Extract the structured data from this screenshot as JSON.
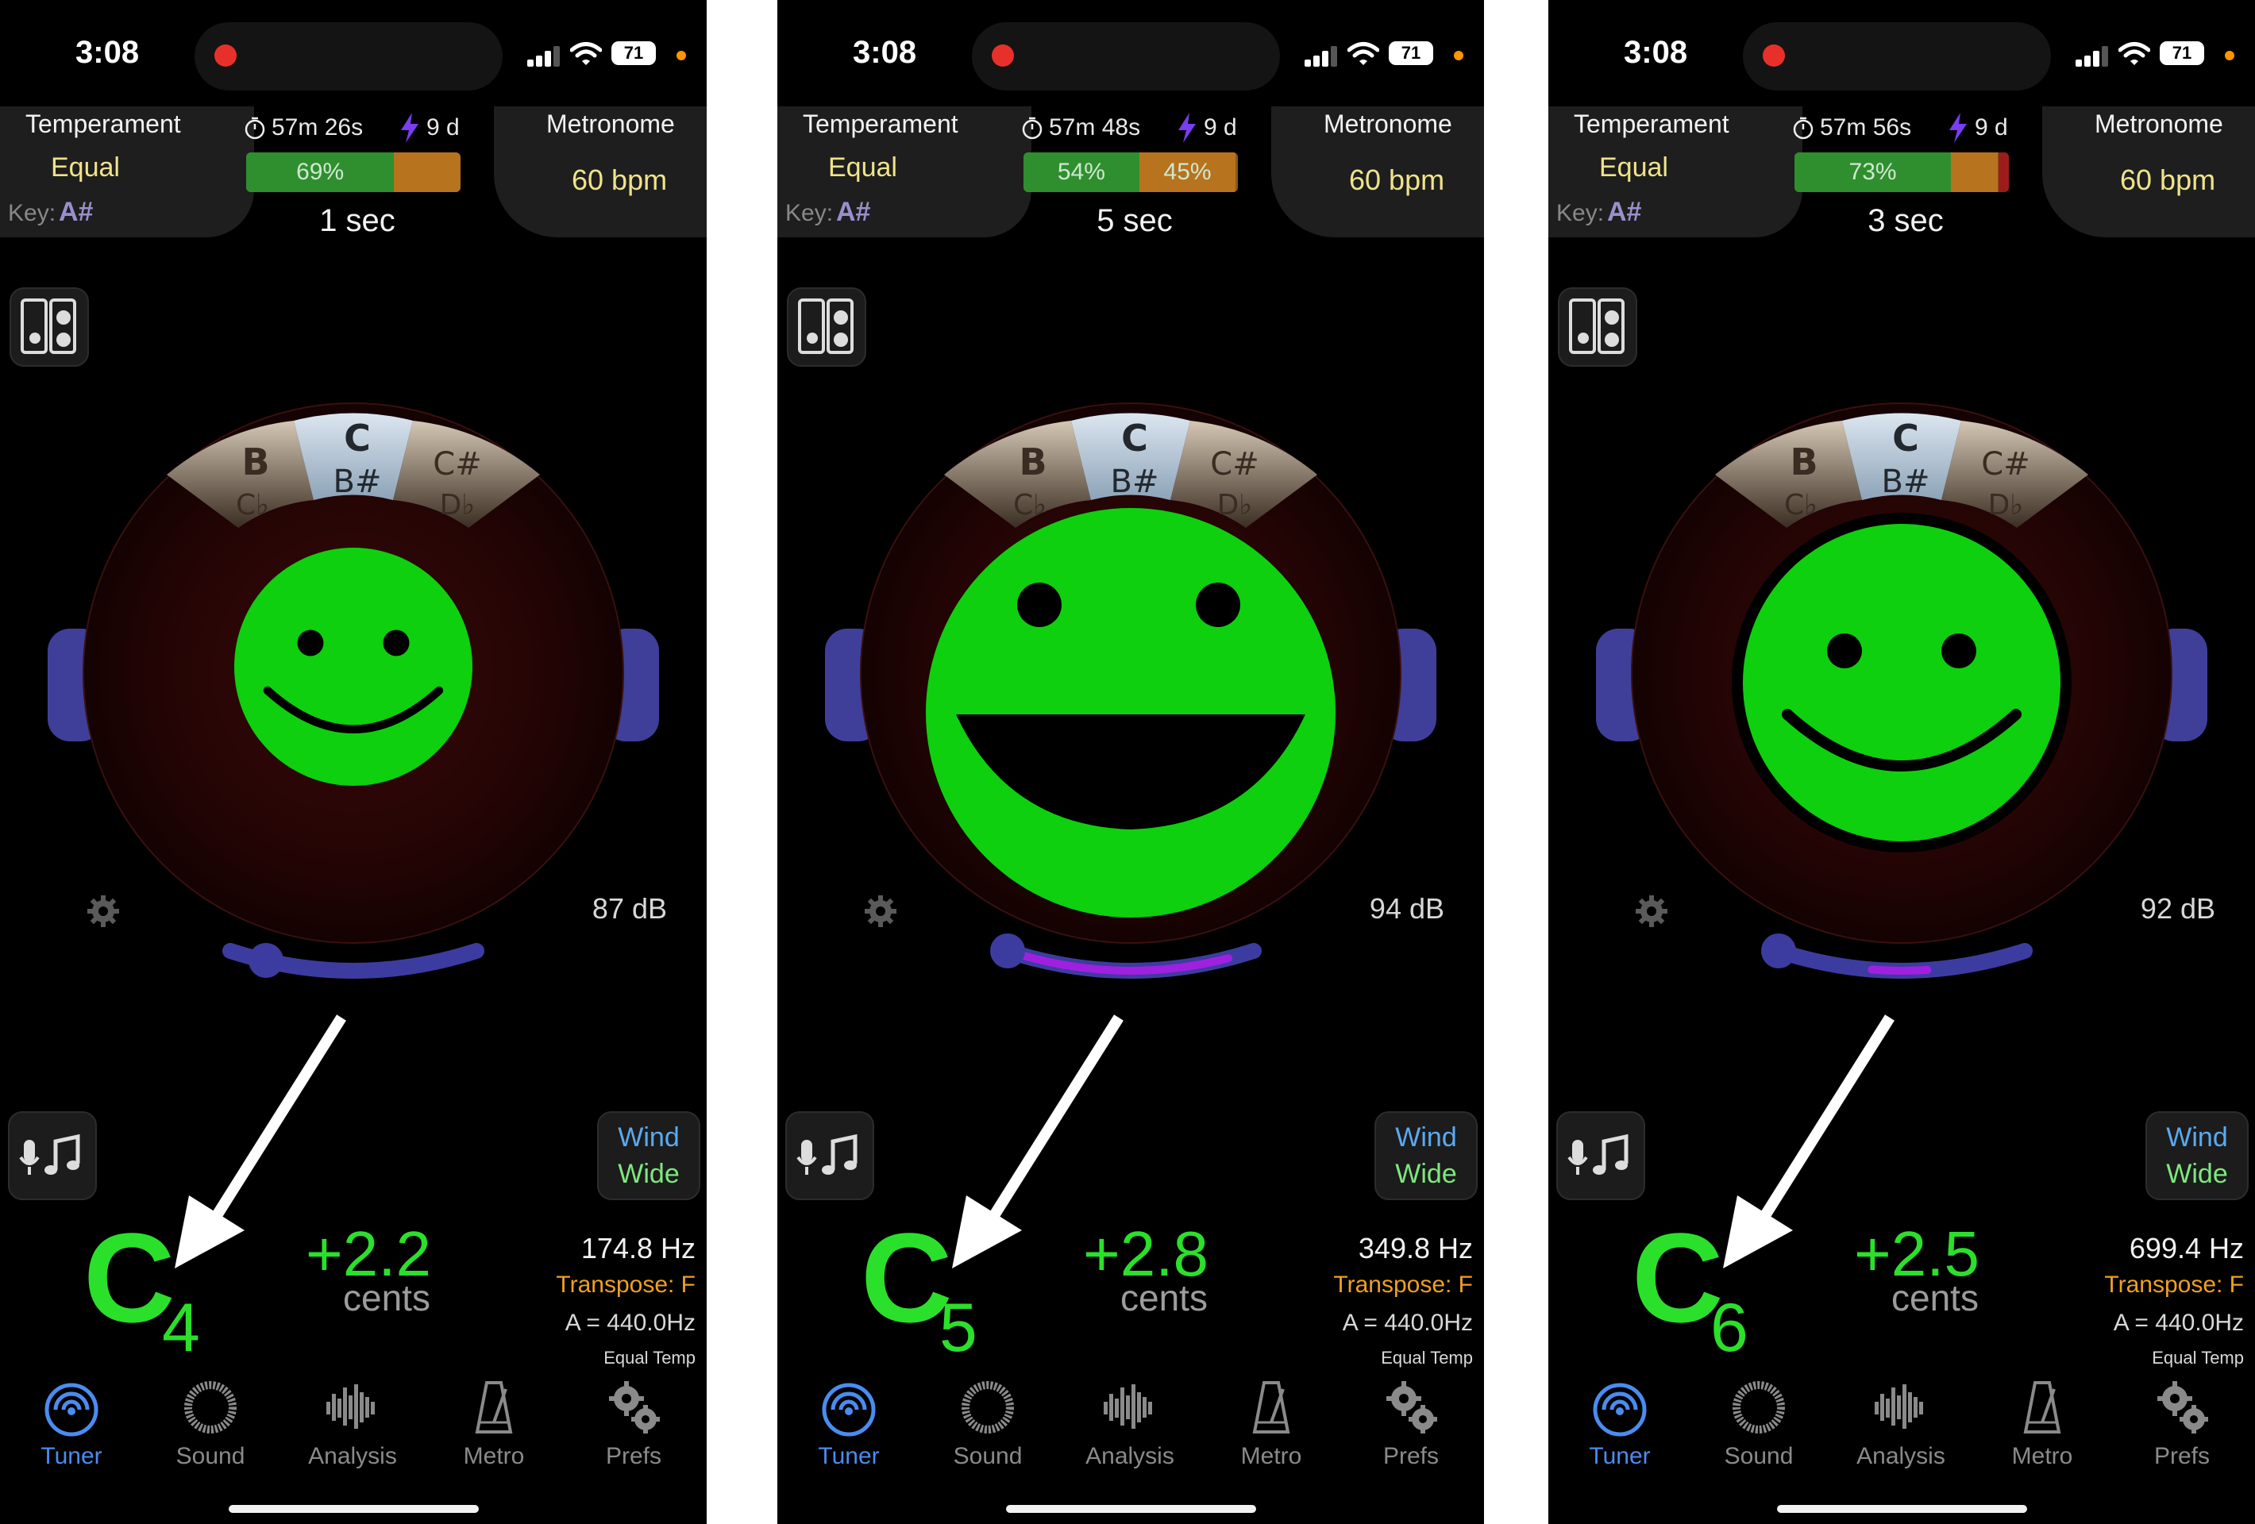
{
  "status_bar": {
    "time": "3:08",
    "battery": "71"
  },
  "header": {
    "temperament_label": "Temperament",
    "temperament_value": "Equal",
    "key_label": "Key:",
    "key_value": "A#",
    "metronome_label": "Metronome",
    "metronome_value": "60 bpm",
    "days": "9 d"
  },
  "buttons": {
    "wind_top": "Wind",
    "wind_bottom": "Wide"
  },
  "dial": {
    "center_note": "C",
    "center_alt": "B#",
    "left_note": "B",
    "left_alt": "C♭",
    "right_note": "C#",
    "right_alt": "D♭"
  },
  "readout": {
    "cents_label": "cents",
    "transpose": "Transpose: F",
    "a_reference": "A = 440.0Hz",
    "temperament_short": "Equal Temp",
    "note": "C"
  },
  "tabs": [
    {
      "label": "Tuner",
      "icon": "tuner-icon",
      "active": true
    },
    {
      "label": "Sound",
      "icon": "sound-icon",
      "active": false
    },
    {
      "label": "Analysis",
      "icon": "analysis-icon",
      "active": false
    },
    {
      "label": "Metro",
      "icon": "metronome-icon",
      "active": false
    },
    {
      "label": "Prefs",
      "icon": "gears-icon",
      "active": false
    }
  ],
  "screens": [
    {
      "timer": "57m 26s",
      "progress": {
        "green_pct": 69,
        "orange_pct": 31,
        "red_pct": 0,
        "green_label": "69%",
        "orange_label": ""
      },
      "hold_time": "1 sec",
      "level": "87 dB",
      "octave": "4",
      "cents": "+2.2",
      "frequency": "174.8 Hz",
      "face": "smile",
      "accuracy_arc_fraction": 0.0
    },
    {
      "timer": "57m 48s",
      "progress": {
        "green_pct": 54,
        "orange_pct": 45,
        "red_pct": 0,
        "green_label": "54%",
        "orange_label": "45%"
      },
      "hold_time": "5 sec",
      "level": "94 dB",
      "octave": "5",
      "cents": "+2.8",
      "frequency": "349.8 Hz",
      "face": "laugh",
      "accuracy_arc_fraction": 0.85
    },
    {
      "timer": "57m 56s",
      "progress": {
        "green_pct": 73,
        "orange_pct": 22,
        "red_pct": 5,
        "green_label": "73%",
        "orange_label": ""
      },
      "hold_time": "3 sec",
      "level": "92 dB",
      "octave": "6",
      "cents": "+2.5",
      "frequency": "699.4 Hz",
      "face": "smile",
      "accuracy_arc_fraction": 0.3
    }
  ]
}
